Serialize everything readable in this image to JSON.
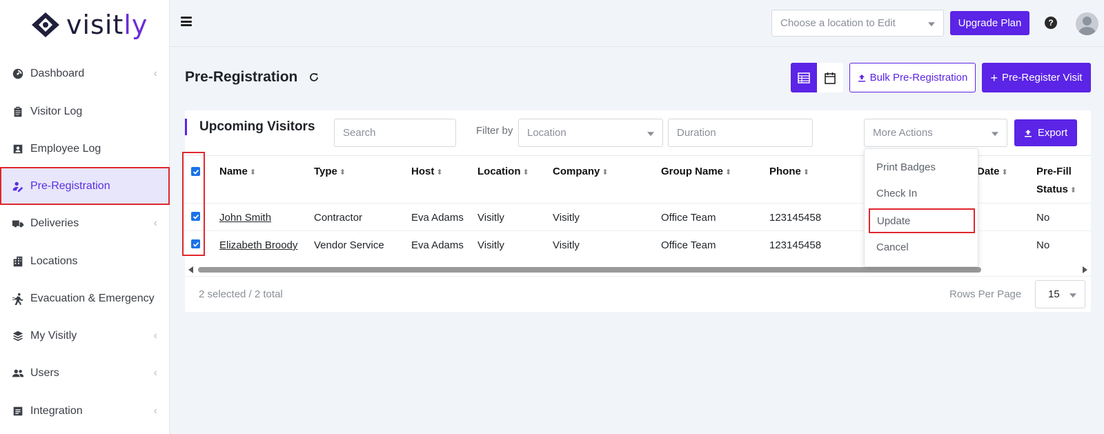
{
  "brand": {
    "name_part1": "visit",
    "name_part2": "ly"
  },
  "sidebar": {
    "items": [
      {
        "label": "Dashboard",
        "icon": "dashboard-icon",
        "has_chevron": true
      },
      {
        "label": "Visitor Log",
        "icon": "clipboard-icon",
        "has_chevron": false
      },
      {
        "label": "Employee Log",
        "icon": "id-card-icon",
        "has_chevron": false
      },
      {
        "label": "Pre-Registration",
        "icon": "user-edit-icon",
        "has_chevron": false,
        "active": true
      },
      {
        "label": "Deliveries",
        "icon": "truck-icon",
        "has_chevron": true
      },
      {
        "label": "Locations",
        "icon": "building-icon",
        "has_chevron": false
      },
      {
        "label": "Evacuation & Emergency",
        "icon": "running-icon",
        "has_chevron": false
      },
      {
        "label": "My Visitly",
        "icon": "layers-icon",
        "has_chevron": true
      },
      {
        "label": "Users",
        "icon": "users-icon",
        "has_chevron": true
      },
      {
        "label": "Integration",
        "icon": "integration-icon",
        "has_chevron": true
      }
    ]
  },
  "topbar": {
    "location_placeholder": "Choose a location to Edit",
    "upgrade_label": "Upgrade Plan",
    "help_glyph": "?"
  },
  "page": {
    "title": "Pre-Registration",
    "bulk_label": "Bulk Pre-Registration",
    "prereg_label": "Pre-Register Visit"
  },
  "card": {
    "title": "Upcoming Visitors",
    "search_placeholder": "Search",
    "filter_label": "Filter by",
    "location_placeholder": "Location",
    "duration_placeholder": "Duration",
    "more_actions_label": "More Actions",
    "export_label": "Export"
  },
  "table": {
    "headers": {
      "name": "Name",
      "type": "Type",
      "host": "Host",
      "location": "Location",
      "company": "Company",
      "group": "Group Name",
      "phone": "Phone",
      "date": "Date",
      "prefill_1": "Pre-Fill",
      "prefill_2": "Status"
    },
    "rows": [
      {
        "name": "John Smith",
        "type": "Contractor",
        "host": "Eva Adams",
        "location": "Visitly",
        "company": "Visitly",
        "group": "Office Team",
        "phone": "123145458",
        "prefill": "No",
        "checked": true
      },
      {
        "name": "Elizabeth Broody",
        "type": "Vendor Service",
        "host": "Eva Adams",
        "location": "Visitly",
        "company": "Visitly",
        "group": "Office Team",
        "phone": "123145458",
        "prefill": "No",
        "checked": true
      }
    ]
  },
  "footer": {
    "selected_info": "2 selected / 2 total",
    "rows_per_page_label": "Rows Per Page",
    "rows_per_page_value": "15"
  },
  "more_actions_menu": {
    "items": [
      "Print Badges",
      "Check In",
      "Update",
      "Cancel"
    ],
    "highlighted": "Update"
  },
  "colors": {
    "accent": "#5b24e6",
    "highlight_border": "#e0262d",
    "checkbox": "#1a73e8"
  }
}
